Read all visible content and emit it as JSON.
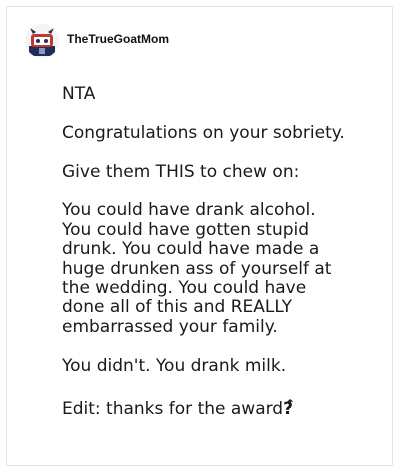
{
  "post": {
    "author": "TheTrueGoatMom",
    "avatar_icon": "goat-avatar-icon",
    "paragraphs": [
      "NTA",
      "Congratulations on your sobriety.",
      "Give them THIS to chew on:",
      "You could have drank alcohol.\nYou could have gotten stupid\ndrunk. You could have made a\nhuge drunken ass of yourself at\nthe wedding. You could have\ndone all of this and REALLY\nembarrassed your family.",
      "You didn't. You drank milk.",
      "Edit: thanks for the award"
    ],
    "edit_suffix": "?",
    "arrow_glyph": "↑"
  },
  "colors": {
    "text": "#1a1a1a",
    "border": "#e2e2e2",
    "avatar_red": "#c0392b",
    "avatar_navy": "#1f2f5c"
  }
}
